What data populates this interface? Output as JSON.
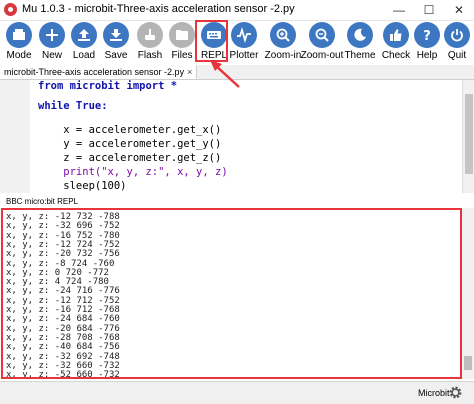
{
  "window": {
    "title": "Mu 1.0.3 - microbit-Three-axis acceleration sensor -2.py"
  },
  "toolbar": {
    "buttons": [
      {
        "id": "mode",
        "label": "Mode",
        "icon": "mode-icon"
      },
      {
        "id": "new",
        "label": "New",
        "icon": "plus-icon"
      },
      {
        "id": "load",
        "label": "Load",
        "icon": "upload-icon"
      },
      {
        "id": "save",
        "label": "Save",
        "icon": "download-icon"
      },
      {
        "id": "flash",
        "label": "Flash",
        "icon": "flash-icon",
        "disabled": true
      },
      {
        "id": "files",
        "label": "Files",
        "icon": "files-icon",
        "disabled": true
      },
      {
        "id": "repl",
        "label": "REPL",
        "icon": "keyboard-icon"
      },
      {
        "id": "plotter",
        "label": "Plotter",
        "icon": "plotter-icon"
      },
      {
        "id": "zoomin",
        "label": "Zoom-in",
        "icon": "zoom-in-icon"
      },
      {
        "id": "zoomout",
        "label": "Zoom-out",
        "icon": "zoom-out-icon"
      },
      {
        "id": "theme",
        "label": "Theme",
        "icon": "theme-icon"
      },
      {
        "id": "check",
        "label": "Check",
        "icon": "thumbs-up-icon"
      },
      {
        "id": "help",
        "label": "Help",
        "icon": "help-icon"
      },
      {
        "id": "quit",
        "label": "Quit",
        "icon": "power-icon"
      }
    ]
  },
  "tab": {
    "filename": "microbit-Three-axis acceleration sensor -2.py",
    "close": "×"
  },
  "editor": {
    "lines": [
      "from microbit import *",
      "",
      "while True:",
      "",
      "    x = accelerometer.get_x()",
      "    y = accelerometer.get_y()",
      "    z = accelerometer.get_z()",
      "    print(\"x, y, z:\", x, y, z)",
      "    sleep(100)"
    ]
  },
  "repl": {
    "title": "BBC micro:bit REPL",
    "lines": [
      "x, y, z: -12 732 -788",
      "x, y, z: -32 696 -752",
      "x, y, z: -16 752 -780",
      "x, y, z: -12 724 -752",
      "x, y, z: -20 732 -756",
      "x, y, z: -8 724 -760",
      "x, y, z: 0 720 -772",
      "x, y, z: 4 724 -780",
      "x, y, z: -24 716 -776",
      "x, y, z: -12 712 -752",
      "x, y, z: -16 712 -768",
      "x, y, z: -24 684 -760",
      "x, y, z: -20 684 -776",
      "x, y, z: -28 708 -768",
      "x, y, z: -40 684 -756",
      "x, y, z: -32 692 -748",
      "x, y, z: -32 660 -732",
      "x, y, z: -52 660 -732"
    ]
  },
  "status": {
    "mode": "Microbit"
  },
  "colors": {
    "toolbar_button": "#3d77c1",
    "highlight": "#e8343a"
  }
}
